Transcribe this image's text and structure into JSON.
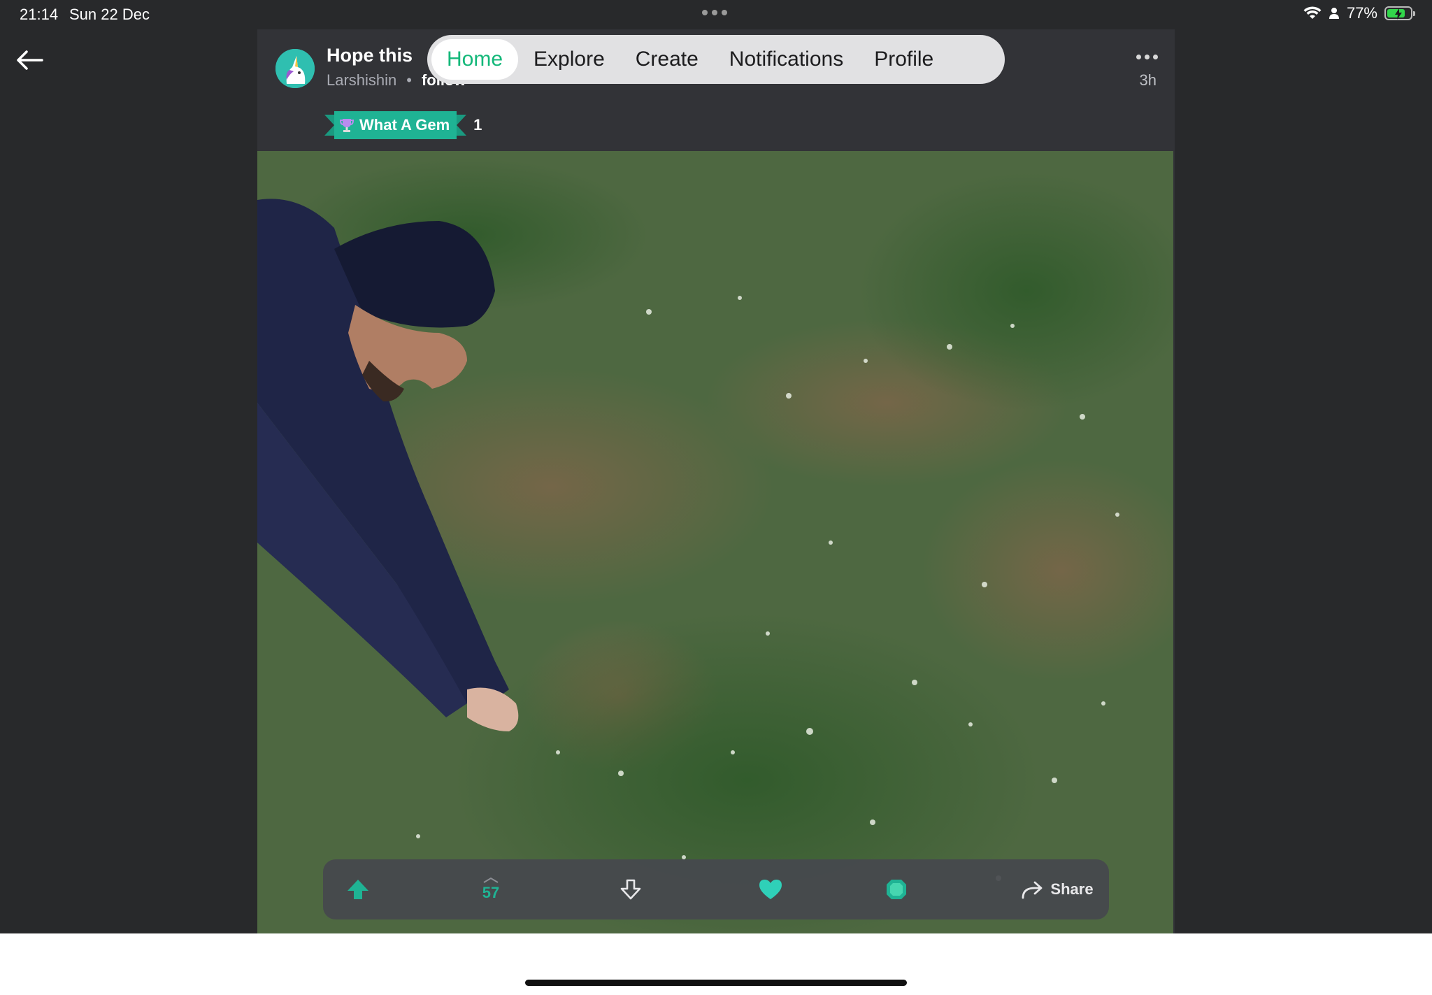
{
  "status_bar": {
    "time": "21:14",
    "date": "Sun 22 Dec",
    "battery": "77%",
    "battery_level": 0.77
  },
  "post": {
    "title": "Hope this",
    "author": "Larshishin",
    "separator": "•",
    "follow_label": "follow",
    "time_ago": "3h",
    "award": {
      "label": "What A Gem",
      "count": "1"
    }
  },
  "nav": {
    "tabs": [
      {
        "label": "Home",
        "active": true
      },
      {
        "label": "Explore",
        "active": false
      },
      {
        "label": "Create",
        "active": false
      },
      {
        "label": "Notifications",
        "active": false
      },
      {
        "label": "Profile",
        "active": false
      }
    ]
  },
  "actions": {
    "score": "57",
    "share_label": "Share"
  },
  "colors": {
    "accent": "#1fb394",
    "active_tab_text": "#14b87a",
    "background": "#28292b",
    "card": "#323337"
  },
  "icons": [
    "back-arrow-icon",
    "wifi-icon",
    "person-icon",
    "battery-icon",
    "upvote-icon",
    "downvote-icon",
    "heart-icon",
    "gem-icon",
    "share-icon",
    "more-options-icon",
    "trophy-icon"
  ]
}
